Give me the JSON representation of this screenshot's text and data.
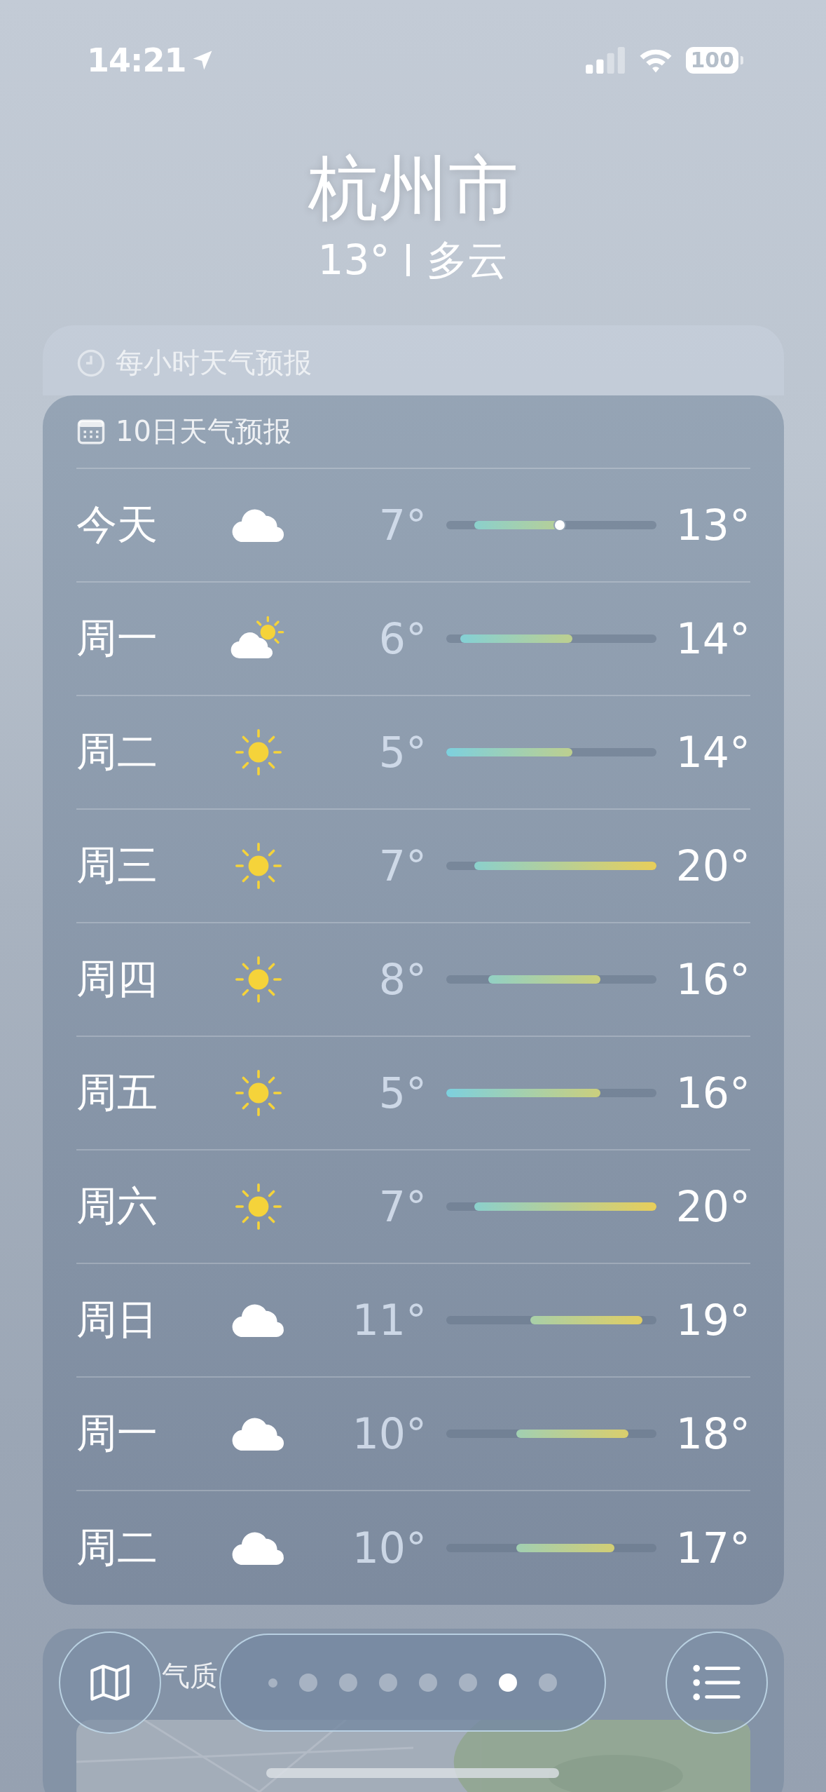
{
  "status_bar": {
    "time": "14:21",
    "battery": "100"
  },
  "location": {
    "city": "杭州市",
    "temperature": "13°",
    "condition": "多云"
  },
  "hourly_card": {
    "title": "每小时天气预报"
  },
  "forecast": {
    "title": "10日天气预报",
    "days": [
      {
        "day": "今天",
        "kind": "cloud",
        "low": "7°",
        "high": "13°",
        "current": true
      },
      {
        "day": "周一",
        "kind": "partly_sunny",
        "low": "6°",
        "high": "14°",
        "current": false
      },
      {
        "day": "周二",
        "kind": "sun",
        "low": "5°",
        "high": "14°",
        "current": false
      },
      {
        "day": "周三",
        "kind": "sun",
        "low": "7°",
        "high": "20°",
        "current": false
      },
      {
        "day": "周四",
        "kind": "sun",
        "low": "8°",
        "high": "16°",
        "current": false
      },
      {
        "day": "周五",
        "kind": "sun",
        "low": "5°",
        "high": "16°",
        "current": false
      },
      {
        "day": "周六",
        "kind": "sun",
        "low": "7°",
        "high": "20°",
        "current": false
      },
      {
        "day": "周日",
        "kind": "cloud",
        "low": "11°",
        "high": "19°",
        "current": false
      },
      {
        "day": "周一",
        "kind": "cloud",
        "low": "10°",
        "high": "18°",
        "current": false
      },
      {
        "day": "周二",
        "kind": "cloud",
        "low": "10°",
        "high": "17°",
        "current": false
      }
    ]
  },
  "air_quality_card": {
    "title": "气质"
  },
  "page_dots": [
    {
      "kind": "location",
      "selected": false
    },
    {
      "kind": "page",
      "selected": false
    },
    {
      "kind": "page",
      "selected": false
    },
    {
      "kind": "page",
      "selected": false
    },
    {
      "kind": "page",
      "selected": false
    },
    {
      "kind": "page",
      "selected": false
    },
    {
      "kind": "page",
      "selected": true
    },
    {
      "kind": "page",
      "selected": false
    }
  ]
}
